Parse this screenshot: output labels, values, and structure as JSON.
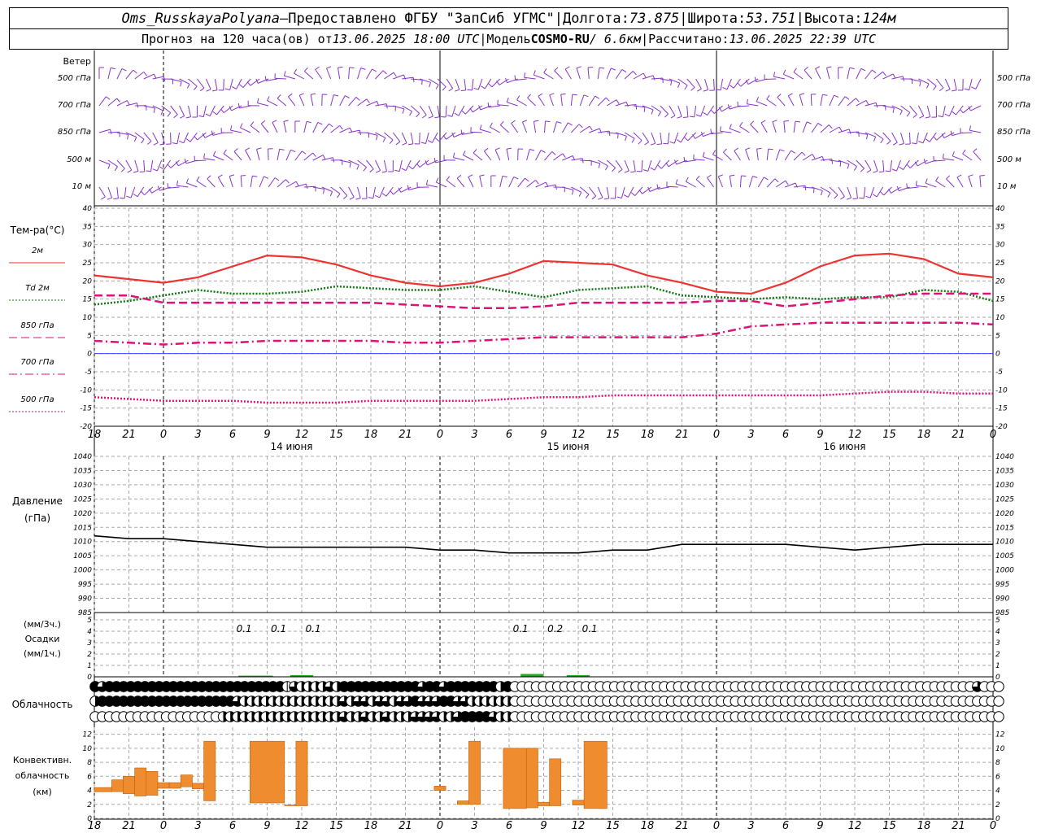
{
  "header": {
    "station": "Oms_RusskayaPolyana",
    "dash": " – ",
    "provider": "Предоставлено ФГБУ \"ЗапСиб УГМС\"",
    "sep": " | ",
    "lon_label": "Долгота: ",
    "lon": "73.875",
    "lat_label": "Широта: ",
    "lat": "53.751",
    "alt_label": "Высота: ",
    "alt": "124м",
    "forecast_label": "Прогноз на 120 часа(ов) от ",
    "forecast_time": "13.06.2025 18:00 UTC",
    "model_label": "Модель ",
    "model": "COSMO-RU",
    "model_res": " / 6.6км",
    "calc_label": "Рассчитано: ",
    "calc_time": "13.06.2025 22:39 UTC"
  },
  "time_axis": {
    "hour_ticks": [
      "18",
      "21",
      "0",
      "3",
      "6",
      "9",
      "12",
      "15",
      "18",
      "21",
      "0",
      "3",
      "6",
      "9",
      "12",
      "15",
      "18",
      "21",
      "0",
      "3",
      "6",
      "9",
      "12",
      "15",
      "18",
      "21",
      "0"
    ],
    "day_labels": [
      {
        "text": "14 июня",
        "hour": 15
      },
      {
        "text": "15 июня",
        "hour": 39
      },
      {
        "text": "16 июня",
        "hour": 63
      }
    ],
    "midnights": [
      6,
      30,
      54,
      78
    ]
  },
  "chart_data": [
    {
      "type": "wind_barbs",
      "title": "Ветер",
      "levels": [
        "500 гПа",
        "700 гПа",
        "850 гПа",
        "500 м",
        "10  м"
      ]
    },
    {
      "type": "line",
      "title": "Тем-ра(°C)",
      "ylim": [
        -20,
        40
      ],
      "yticks": [
        -20,
        -15,
        -10,
        -5,
        0,
        5,
        10,
        15,
        20,
        25,
        30,
        35,
        40
      ],
      "x_hours": [
        0,
        3,
        6,
        9,
        12,
        15,
        18,
        21,
        24,
        27,
        30,
        33,
        36,
        39,
        42,
        45,
        48,
        51,
        54,
        57,
        60,
        63,
        66,
        69,
        72,
        75,
        78
      ],
      "series": [
        {
          "name": "2м",
          "color": "#ee3333",
          "style": "solid",
          "values": [
            21.5,
            20.5,
            19.5,
            21,
            24,
            27,
            26.5,
            24.5,
            21.5,
            19.5,
            18.5,
            19.5,
            22,
            25.5,
            25,
            24.5,
            21.5,
            19.5,
            17,
            16.5,
            19.5,
            24,
            27,
            27.5,
            26,
            22,
            21
          ]
        },
        {
          "name": "Td 2м",
          "color": "#117711",
          "style": "dots",
          "values": [
            13.5,
            14.5,
            16,
            17.5,
            16.5,
            16.5,
            17,
            18.5,
            18,
            17.5,
            17.5,
            18.5,
            17,
            15.5,
            17.5,
            18,
            18.5,
            16,
            15.5,
            15,
            15.5,
            15,
            15.5,
            15.5,
            17.5,
            17,
            14.5
          ]
        },
        {
          "name": "850 гПа",
          "color": "#dd1177",
          "style": "dash",
          "values": [
            16,
            16,
            14,
            14,
            14,
            14,
            14,
            14,
            14,
            13.5,
            13,
            12.5,
            12.5,
            13,
            14,
            14,
            14,
            14,
            14.5,
            14.5,
            13,
            14,
            15,
            16,
            16.5,
            16.5,
            16.5
          ]
        },
        {
          "name": "700 гПа",
          "color": "#dd1177",
          "style": "dashdot",
          "values": [
            3.5,
            3,
            2.5,
            3,
            3,
            3.5,
            3.5,
            3.5,
            3.5,
            3,
            3,
            3.5,
            4,
            4.5,
            4.5,
            4.5,
            4.5,
            4.5,
            5.5,
            7.5,
            8,
            8.5,
            8.5,
            8.5,
            8.5,
            8.5,
            8
          ]
        },
        {
          "name": "500 гПа",
          "color": "#dd1177",
          "style": "dots",
          "values": [
            -12,
            -12.5,
            -13,
            -13,
            -13,
            -13.5,
            -13.5,
            -13.5,
            -13,
            -13,
            -13,
            -13,
            -12.5,
            -12,
            -12,
            -11.5,
            -11.5,
            -11.5,
            -11.5,
            -11.5,
            -11.5,
            -11.5,
            -11,
            -10.5,
            -10.5,
            -11,
            -11
          ]
        }
      ]
    },
    {
      "type": "line",
      "title": "Давление",
      "unit": "(гПа)",
      "ylim": [
        985,
        1040
      ],
      "yticks": [
        985,
        990,
        995,
        1000,
        1005,
        1010,
        1015,
        1020,
        1025,
        1030,
        1035,
        1040
      ],
      "x_hours": [
        0,
        3,
        6,
        9,
        12,
        15,
        18,
        21,
        24,
        27,
        30,
        33,
        36,
        39,
        42,
        45,
        48,
        51,
        54,
        57,
        60,
        63,
        66,
        69,
        72,
        75,
        78
      ],
      "series": [
        {
          "name": "",
          "color": "#000000",
          "values": [
            1012,
            1011,
            1011,
            1010,
            1009,
            1008,
            1008,
            1008,
            1008,
            1008,
            1007,
            1007,
            1006,
            1006,
            1006,
            1007,
            1007,
            1009,
            1009,
            1009,
            1009,
            1008,
            1007,
            1008,
            1009,
            1009,
            1009
          ]
        }
      ]
    },
    {
      "type": "bar",
      "title": "Осадки",
      "unit_3h": "(мм/3ч.)",
      "unit_1h": "(мм/1ч.)",
      "ylim": [
        0,
        5
      ],
      "yticks": [
        0,
        1,
        2,
        3,
        4,
        5
      ],
      "labels": [
        {
          "hour": 13,
          "text": "0.1"
        },
        {
          "hour": 16,
          "text": "0.1"
        },
        {
          "hour": 19,
          "text": "0.1"
        },
        {
          "hour": 37,
          "text": "0.1"
        },
        {
          "hour": 40,
          "text": "0.2"
        },
        {
          "hour": 43,
          "text": "0.1"
        }
      ],
      "bars": [
        {
          "start": 12.5,
          "end": 15.5,
          "value": 0.1
        },
        {
          "start": 17,
          "end": 19,
          "value": 0.15
        },
        {
          "start": 37,
          "end": 39,
          "value": 0.25
        },
        {
          "start": 41,
          "end": 43,
          "value": 0.15
        }
      ],
      "color": "#22aa22"
    },
    {
      "type": "cloud_cover",
      "title": "Облачность",
      "rows": [
        [
          4,
          3,
          4,
          4,
          4,
          4,
          4,
          4,
          4,
          4,
          4,
          4,
          4,
          4,
          4,
          4,
          4,
          4,
          4,
          4,
          4,
          4,
          4,
          4,
          4,
          4,
          4,
          1,
          3,
          2,
          2,
          2,
          2,
          3,
          2,
          4,
          4,
          4,
          4,
          4,
          4,
          4,
          4,
          4,
          4,
          4,
          3,
          4,
          4,
          3,
          4,
          4,
          4,
          4,
          4,
          4,
          4,
          2,
          4,
          0,
          0,
          0,
          0,
          0,
          0,
          0,
          0,
          0,
          0,
          0,
          0,
          0,
          0,
          0,
          0,
          0,
          0,
          0,
          0,
          0,
          0,
          0,
          0,
          0,
          0,
          0,
          0,
          0,
          0,
          0,
          0,
          0,
          0,
          0,
          0,
          0,
          0,
          0,
          0,
          0,
          0,
          0,
          0,
          0,
          0,
          0,
          0,
          0,
          0,
          0,
          0,
          0,
          0,
          0,
          0,
          0,
          0,
          0,
          0,
          0,
          0,
          0,
          0,
          0,
          3,
          0,
          0,
          0
        ],
        [
          2,
          4,
          4,
          4,
          4,
          4,
          4,
          4,
          4,
          4,
          4,
          4,
          4,
          4,
          4,
          4,
          4,
          4,
          4,
          4,
          3,
          2,
          2,
          2,
          2,
          2,
          2,
          2,
          2,
          2,
          2,
          2,
          2,
          2,
          2,
          3,
          2,
          3,
          3,
          2,
          3,
          3,
          2,
          3,
          3,
          4,
          3,
          3,
          3,
          4,
          4,
          3,
          3,
          2,
          2,
          2,
          2,
          2,
          2,
          0,
          0,
          0,
          0,
          0,
          0,
          0,
          0,
          0,
          0,
          0,
          0,
          0,
          0,
          0,
          0,
          0,
          0,
          0,
          0,
          0,
          0,
          0,
          0,
          0,
          0,
          0,
          0,
          0,
          0,
          0,
          0,
          0,
          0,
          0,
          0,
          0,
          0,
          0,
          0,
          0,
          0,
          0,
          0,
          0,
          0,
          0,
          0,
          0,
          0,
          0,
          0,
          0,
          0,
          0,
          0,
          0,
          0,
          0,
          0,
          0,
          0,
          0,
          0,
          0,
          0,
          0,
          0,
          0
        ],
        [
          0,
          0,
          0,
          0,
          0,
          0,
          0,
          0,
          0,
          0,
          0,
          0,
          0,
          0,
          0,
          0,
          0,
          0,
          2,
          2,
          2,
          2,
          2,
          2,
          2,
          2,
          2,
          2,
          2,
          2,
          2,
          2,
          2,
          2,
          2,
          3,
          2,
          2,
          3,
          2,
          2,
          3,
          2,
          2,
          2,
          3,
          3,
          3,
          3,
          2,
          2,
          3,
          4,
          4,
          4,
          4,
          3,
          2,
          2,
          0,
          0,
          0,
          0,
          0,
          0,
          0,
          0,
          0,
          0,
          0,
          0,
          0,
          0,
          0,
          0,
          0,
          0,
          0,
          0,
          0,
          0,
          0,
          0,
          0,
          0,
          0,
          0,
          0,
          0,
          0,
          0,
          0,
          0,
          0,
          0,
          0,
          0,
          0,
          0,
          0,
          0,
          0,
          0,
          0,
          0,
          0,
          0,
          0,
          0,
          0,
          0,
          0,
          0,
          0,
          0,
          0,
          0,
          0,
          0,
          0,
          0,
          0,
          0,
          0,
          0,
          0,
          0,
          0
        ]
      ]
    },
    {
      "type": "bar",
      "title": "Конвективн.",
      "title2": "облачность",
      "unit": "(км)",
      "ylim": [
        0,
        13
      ],
      "yticks": [
        0,
        2,
        4,
        6,
        8,
        10,
        12
      ],
      "color": "#f08c30",
      "bars": [
        {
          "start": 0,
          "end": 1.5,
          "bottom": 3.8,
          "top": 4.4
        },
        {
          "start": 1.5,
          "end": 2.5,
          "bottom": 3.8,
          "top": 5.5
        },
        {
          "start": 2.5,
          "end": 3.5,
          "bottom": 3.5,
          "top": 6
        },
        {
          "start": 3.5,
          "end": 4.5,
          "bottom": 3.2,
          "top": 7.2
        },
        {
          "start": 4.5,
          "end": 5.5,
          "bottom": 3.3,
          "top": 6.7
        },
        {
          "start": 5.5,
          "end": 6.5,
          "bottom": 4.3,
          "top": 5.1
        },
        {
          "start": 6.5,
          "end": 7.5,
          "bottom": 4.3,
          "top": 5.1
        },
        {
          "start": 7.5,
          "end": 8.5,
          "bottom": 4.5,
          "top": 6.2
        },
        {
          "start": 8.5,
          "end": 9.5,
          "bottom": 4.2,
          "top": 5
        },
        {
          "start": 9.5,
          "end": 10.5,
          "bottom": 2.5,
          "top": 11
        },
        {
          "start": 13.5,
          "end": 16.5,
          "bottom": 2.2,
          "top": 11
        },
        {
          "start": 16.5,
          "end": 17.5,
          "bottom": 1.8,
          "top": 1.9
        },
        {
          "start": 17.5,
          "end": 18.5,
          "bottom": 1.8,
          "top": 11
        },
        {
          "start": 29.5,
          "end": 30.5,
          "bottom": 4,
          "top": 4.6
        },
        {
          "start": 31.5,
          "end": 32.5,
          "bottom": 2,
          "top": 2.5
        },
        {
          "start": 32.5,
          "end": 33.5,
          "bottom": 2,
          "top": 11
        },
        {
          "start": 35.5,
          "end": 37.5,
          "bottom": 1.4,
          "top": 10
        },
        {
          "start": 37.5,
          "end": 38.5,
          "bottom": 1.5,
          "top": 10
        },
        {
          "start": 38.5,
          "end": 39.5,
          "bottom": 1.8,
          "top": 2.3
        },
        {
          "start": 39.5,
          "end": 40.5,
          "bottom": 1.8,
          "top": 8.5
        },
        {
          "start": 41.5,
          "end": 42.5,
          "bottom": 1.9,
          "top": 2.6
        },
        {
          "start": 42.5,
          "end": 44.5,
          "bottom": 1.4,
          "top": 11
        }
      ]
    }
  ]
}
